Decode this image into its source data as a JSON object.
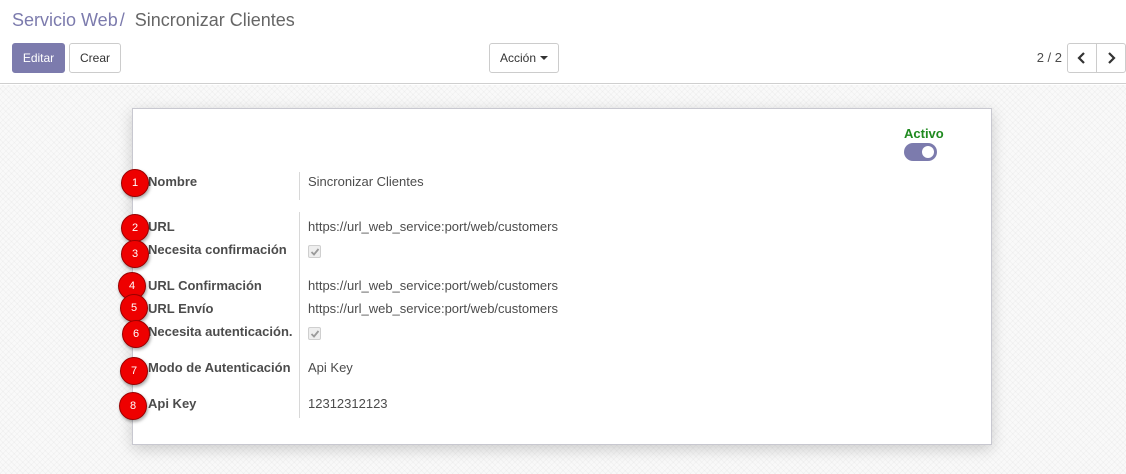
{
  "breadcrumb": {
    "parent": "Servicio Web",
    "separator": "/",
    "current": "Sincronizar Clientes"
  },
  "buttons": {
    "edit": "Editar",
    "create": "Crear",
    "action": "Acción"
  },
  "pager": {
    "value": "2 / 2",
    "prev_icon": "chevron-left-icon",
    "next_icon": "chevron-right-icon"
  },
  "status": {
    "label": "Activo",
    "active": true
  },
  "fields": [
    {
      "label": "Nombre",
      "value": "Sincronizar Clientes",
      "marker": "1"
    },
    {
      "label": "URL",
      "value": "https://url_web_service:port/web/customers",
      "marker": "2"
    },
    {
      "label": "Necesita confirmación",
      "checked": true,
      "marker": "3"
    },
    {
      "label": "URL Confirmación",
      "value": "https://url_web_service:port/web/customers",
      "marker": "4"
    },
    {
      "label": "URL Envío",
      "value": "https://url_web_service:port/web/customers",
      "marker": "5"
    },
    {
      "label": "Necesita autenticación.",
      "checked": true,
      "marker": "6"
    },
    {
      "label": "Modo de Autenticación",
      "value": "Api Key",
      "marker": "7"
    },
    {
      "label": "Api Key",
      "value": "12312312123",
      "marker": "8"
    }
  ],
  "colors": {
    "brand": "#7c7bad",
    "active_text": "#1f8a1f",
    "marker": "#ee0000"
  }
}
